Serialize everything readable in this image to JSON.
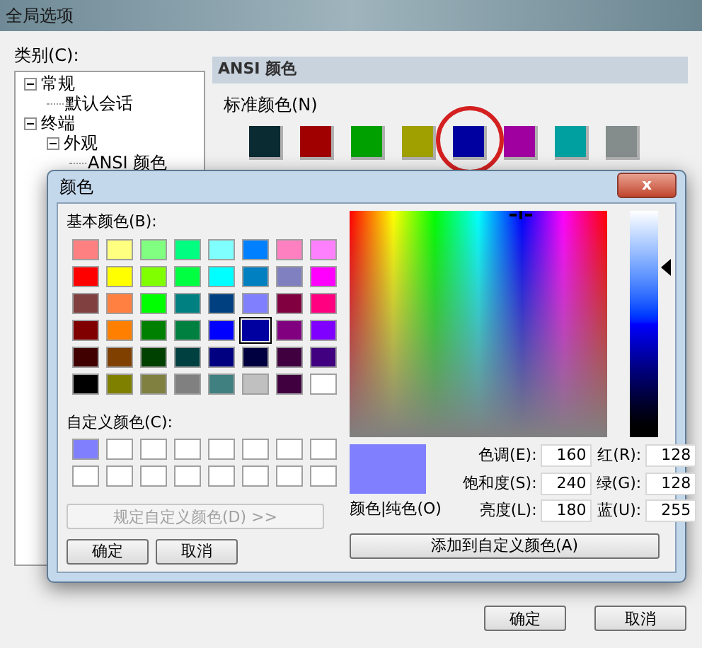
{
  "window": {
    "title": "全局选项"
  },
  "category_label": "类别(C):",
  "tree": [
    {
      "label": "常规",
      "expanded": true,
      "children": [
        {
          "label": "默认会话"
        }
      ]
    },
    {
      "label": "终端",
      "expanded": true,
      "children": [
        {
          "label": "外观",
          "expanded": true,
          "children": [
            {
              "label": "ANSI 颜色"
            }
          ]
        }
      ]
    }
  ],
  "panel": {
    "header": "ANSI 颜色",
    "group_label": "标准颜色(N)",
    "swatches": [
      {
        "color": "#0b2b33",
        "circled": false
      },
      {
        "color": "#a00000",
        "circled": false
      },
      {
        "color": "#00a000",
        "circled": false
      },
      {
        "color": "#a0a000",
        "circled": false
      },
      {
        "color": "#0000a0",
        "circled": true
      },
      {
        "color": "#a000a0",
        "circled": false
      },
      {
        "color": "#00a0a0",
        "circled": false
      },
      {
        "color": "#848c8c",
        "circled": false
      }
    ]
  },
  "color_dialog": {
    "title": "颜色",
    "close": "x",
    "basic_label": "基本颜色(B):",
    "basic_colors": [
      {
        "color": "#ff8080",
        "selected": false
      },
      {
        "color": "#ffff80",
        "selected": false
      },
      {
        "color": "#80ff80",
        "selected": false
      },
      {
        "color": "#00ff80",
        "selected": false
      },
      {
        "color": "#80ffff",
        "selected": false
      },
      {
        "color": "#0080ff",
        "selected": false
      },
      {
        "color": "#ff80c0",
        "selected": false
      },
      {
        "color": "#ff80ff",
        "selected": false
      },
      {
        "color": "#ff0000",
        "selected": false
      },
      {
        "color": "#ffff00",
        "selected": false
      },
      {
        "color": "#80ff00",
        "selected": false
      },
      {
        "color": "#00ff40",
        "selected": false
      },
      {
        "color": "#00ffff",
        "selected": false
      },
      {
        "color": "#0080c0",
        "selected": false
      },
      {
        "color": "#8080c0",
        "selected": false
      },
      {
        "color": "#ff00ff",
        "selected": false
      },
      {
        "color": "#804040",
        "selected": false
      },
      {
        "color": "#ff8040",
        "selected": false
      },
      {
        "color": "#00ff00",
        "selected": false
      },
      {
        "color": "#008080",
        "selected": false
      },
      {
        "color": "#004080",
        "selected": false
      },
      {
        "color": "#8080ff",
        "selected": false
      },
      {
        "color": "#800040",
        "selected": false
      },
      {
        "color": "#ff0080",
        "selected": false
      },
      {
        "color": "#800000",
        "selected": false
      },
      {
        "color": "#ff8000",
        "selected": false
      },
      {
        "color": "#008000",
        "selected": false
      },
      {
        "color": "#008040",
        "selected": false
      },
      {
        "color": "#0000ff",
        "selected": false
      },
      {
        "color": "#0000a0",
        "selected": true
      },
      {
        "color": "#800080",
        "selected": false
      },
      {
        "color": "#8000ff",
        "selected": false
      },
      {
        "color": "#400000",
        "selected": false
      },
      {
        "color": "#804000",
        "selected": false
      },
      {
        "color": "#004000",
        "selected": false
      },
      {
        "color": "#004040",
        "selected": false
      },
      {
        "color": "#000080",
        "selected": false
      },
      {
        "color": "#000040",
        "selected": false
      },
      {
        "color": "#400040",
        "selected": false
      },
      {
        "color": "#400080",
        "selected": false
      },
      {
        "color": "#000000",
        "selected": false
      },
      {
        "color": "#808000",
        "selected": false
      },
      {
        "color": "#808040",
        "selected": false
      },
      {
        "color": "#808080",
        "selected": false
      },
      {
        "color": "#408080",
        "selected": false
      },
      {
        "color": "#c0c0c0",
        "selected": false
      },
      {
        "color": "#400040",
        "selected": false
      },
      {
        "color": "#ffffff",
        "selected": false
      }
    ],
    "custom_label": "自定义颜色(C):",
    "custom_colors": [
      {
        "color": "#8080ff"
      },
      {
        "color": "#ffffff"
      },
      {
        "color": "#ffffff"
      },
      {
        "color": "#ffffff"
      },
      {
        "color": "#ffffff"
      },
      {
        "color": "#ffffff"
      },
      {
        "color": "#ffffff"
      },
      {
        "color": "#ffffff"
      },
      {
        "color": "#ffffff"
      },
      {
        "color": "#ffffff"
      },
      {
        "color": "#ffffff"
      },
      {
        "color": "#ffffff"
      },
      {
        "color": "#ffffff"
      },
      {
        "color": "#ffffff"
      },
      {
        "color": "#ffffff"
      },
      {
        "color": "#ffffff"
      }
    ],
    "define_button": {
      "label": "规定自定义颜色(D) >>",
      "disabled": true
    },
    "ok": "确定",
    "cancel": "取消",
    "luminance": {
      "level": 0.75
    },
    "preview": {
      "color": "#8080ff",
      "label": "颜色|纯色(O)"
    },
    "fields": [
      {
        "label": "色调(E):",
        "value": "160"
      },
      {
        "label": "红(R):",
        "value": "128"
      },
      {
        "label": "饱和度(S):",
        "value": "240"
      },
      {
        "label": "绿(G):",
        "value": "128"
      },
      {
        "label": "亮度(L):",
        "value": "180"
      },
      {
        "label": "蓝(U):",
        "value": "255"
      }
    ],
    "add_button": "添加到自定义颜色(A)"
  },
  "buttons": [
    "确定",
    "取消"
  ]
}
